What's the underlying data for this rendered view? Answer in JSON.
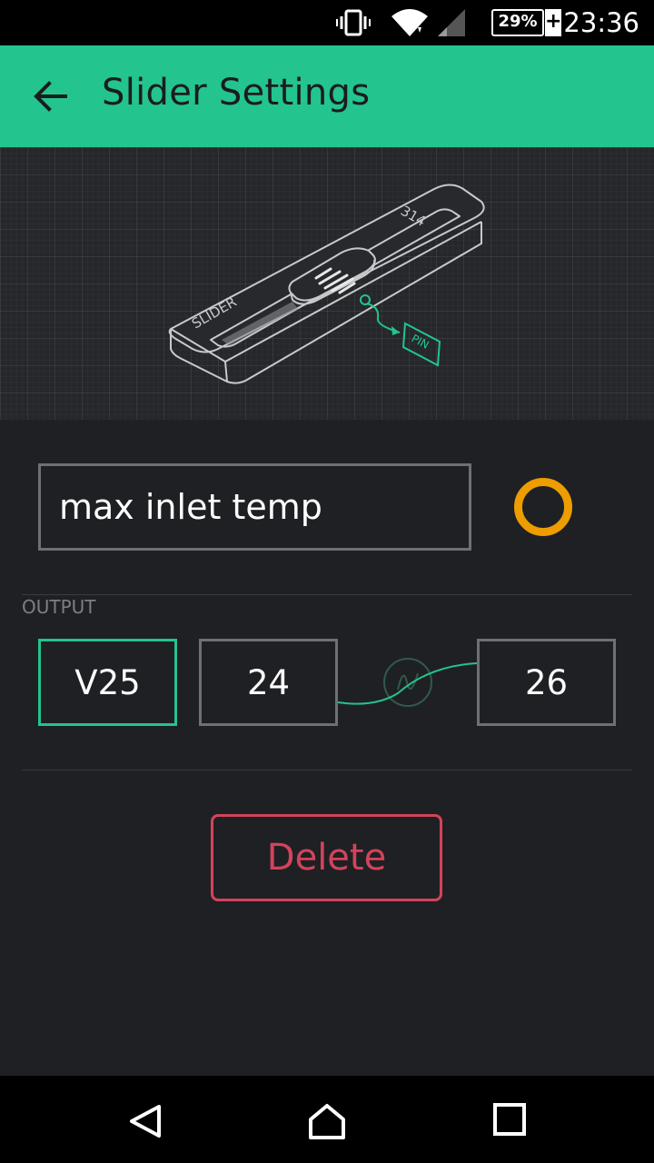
{
  "status_bar": {
    "battery_percent": "29%",
    "charging_symbol": "+",
    "time": "23:36",
    "icons": [
      "vibrate-icon",
      "wifi-icon",
      "signal-icon",
      "battery-icon"
    ]
  },
  "app_bar": {
    "title": "Slider Settings",
    "back_icon": "back-arrow-icon",
    "background_color": "#23c48e"
  },
  "illustration": {
    "widget_label": "SLIDER",
    "widget_value": "314",
    "pin_label": "PIN"
  },
  "name_field": {
    "value": "max inlet temp"
  },
  "color_picker": {
    "color": "#ED9D00"
  },
  "output": {
    "label": "OUTPUT",
    "pin": "V25",
    "min": "24",
    "max": "26"
  },
  "delete_button": {
    "label": "Delete",
    "color": "#d3435c"
  },
  "nav_bar": {
    "icons": [
      "back-triangle-icon",
      "home-icon",
      "recents-square-icon"
    ]
  }
}
